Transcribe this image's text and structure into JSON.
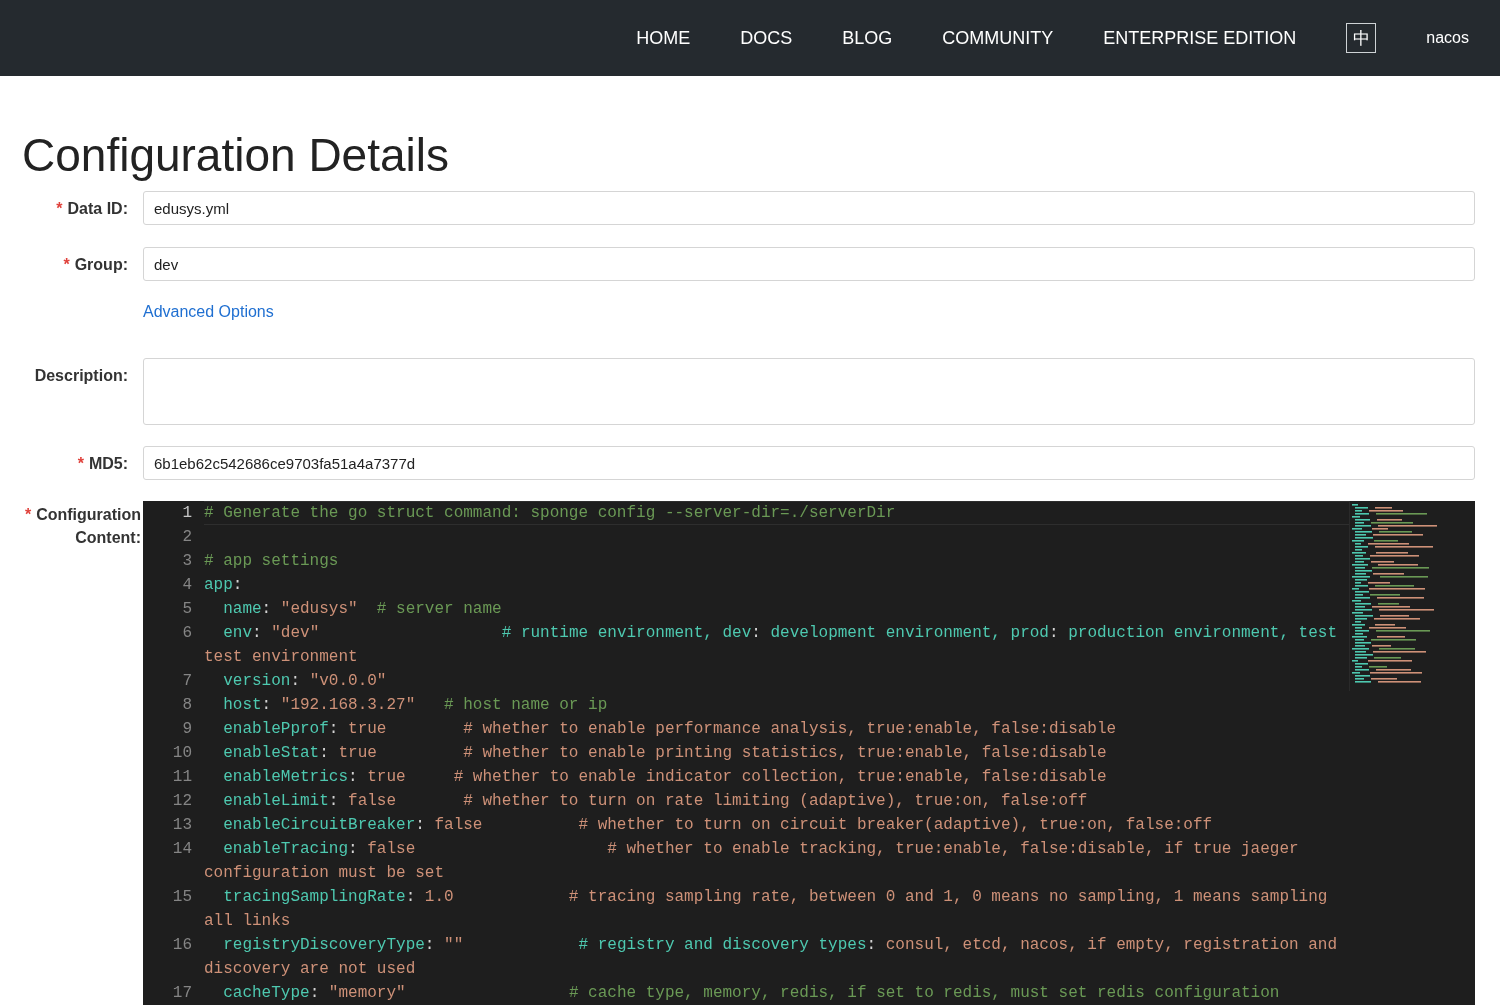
{
  "nav": {
    "items": [
      "HOME",
      "DOCS",
      "BLOG",
      "COMMUNITY",
      "ENTERPRISE EDITION"
    ],
    "language_toggle": "中",
    "user": "nacos"
  },
  "title": "Configuration Details",
  "required_mark": "*",
  "fields": [
    {
      "kind": "input",
      "label": "Data ID:",
      "required": true,
      "value": "edusys.yml"
    },
    {
      "kind": "input",
      "label": "Group:",
      "required": true,
      "value": "dev"
    },
    {
      "kind": "link",
      "text": "Advanced Options"
    },
    {
      "kind": "textarea",
      "label": "Description:",
      "required": false
    },
    {
      "kind": "input",
      "label": "MD5:",
      "required": true,
      "value": "6b1eb62c542686ce9703fa51a4a7377d"
    }
  ],
  "editor": {
    "label_lines": [
      "Configuration",
      "Content:"
    ],
    "required": true,
    "lines": [
      {
        "number": "1",
        "current": true,
        "rows": [
          [
            {
              "kind": "comment",
              "text": "# Generate the go struct command: sponge config --server-dir=./serverDir"
            }
          ]
        ]
      },
      {
        "number": "2",
        "current": false,
        "rows": [
          []
        ]
      },
      {
        "number": "3",
        "current": false,
        "rows": [
          [
            {
              "kind": "comment",
              "text": "# app settings"
            }
          ]
        ]
      },
      {
        "number": "4",
        "current": false,
        "rows": [
          [
            {
              "kind": "key",
              "text": "app"
            },
            {
              "kind": "punct",
              "text": ":"
            }
          ]
        ]
      },
      {
        "number": "5",
        "current": false,
        "rows": [
          [
            {
              "kind": "plain",
              "text": "  "
            },
            {
              "kind": "key",
              "text": "name"
            },
            {
              "kind": "punct",
              "text": ": "
            },
            {
              "kind": "value",
              "text": "\"edusys\""
            },
            {
              "kind": "plain",
              "text": "  "
            },
            {
              "kind": "comment",
              "text": "# server name"
            }
          ]
        ]
      },
      {
        "number": "6",
        "current": false,
        "rows": [
          [
            {
              "kind": "plain",
              "text": "  "
            },
            {
              "kind": "key",
              "text": "env"
            },
            {
              "kind": "punct",
              "text": ": "
            },
            {
              "kind": "value",
              "text": "\"dev\""
            },
            {
              "kind": "plain",
              "text": "                   "
            },
            {
              "kind": "key",
              "text": "# runtime environment, dev"
            },
            {
              "kind": "punct",
              "text": ": "
            },
            {
              "kind": "key",
              "text": "development environment, prod"
            },
            {
              "kind": "punct",
              "text": ": "
            },
            {
              "kind": "key",
              "text": "production environment, test"
            }
          ],
          [
            {
              "kind": "value",
              "text": "test environment"
            }
          ]
        ]
      },
      {
        "number": "7",
        "current": false,
        "rows": [
          [
            {
              "kind": "plain",
              "text": "  "
            },
            {
              "kind": "key",
              "text": "version"
            },
            {
              "kind": "punct",
              "text": ": "
            },
            {
              "kind": "value",
              "text": "\"v0.0.0\""
            }
          ]
        ]
      },
      {
        "number": "8",
        "current": false,
        "rows": [
          [
            {
              "kind": "plain",
              "text": "  "
            },
            {
              "kind": "key",
              "text": "host"
            },
            {
              "kind": "punct",
              "text": ": "
            },
            {
              "kind": "value",
              "text": "\"192.168.3.27\""
            },
            {
              "kind": "plain",
              "text": "   "
            },
            {
              "kind": "comment",
              "text": "# host name or ip"
            }
          ]
        ]
      },
      {
        "number": "9",
        "current": false,
        "rows": [
          [
            {
              "kind": "plain",
              "text": "  "
            },
            {
              "kind": "key",
              "text": "enablePprof"
            },
            {
              "kind": "punct",
              "text": ": "
            },
            {
              "kind": "value",
              "text": "true        # whether to enable performance analysis, true:enable, false:disable"
            }
          ]
        ]
      },
      {
        "number": "10",
        "current": false,
        "rows": [
          [
            {
              "kind": "plain",
              "text": "  "
            },
            {
              "kind": "key",
              "text": "enableStat"
            },
            {
              "kind": "punct",
              "text": ": "
            },
            {
              "kind": "value",
              "text": "true         # whether to enable printing statistics, true:enable, false:disable"
            }
          ]
        ]
      },
      {
        "number": "11",
        "current": false,
        "rows": [
          [
            {
              "kind": "plain",
              "text": "  "
            },
            {
              "kind": "key",
              "text": "enableMetrics"
            },
            {
              "kind": "punct",
              "text": ": "
            },
            {
              "kind": "value",
              "text": "true     # whether to enable indicator collection, true:enable, false:disable"
            }
          ]
        ]
      },
      {
        "number": "12",
        "current": false,
        "rows": [
          [
            {
              "kind": "plain",
              "text": "  "
            },
            {
              "kind": "key",
              "text": "enableLimit"
            },
            {
              "kind": "punct",
              "text": ": "
            },
            {
              "kind": "value",
              "text": "false       # whether to turn on rate limiting (adaptive), true:on, false:off"
            }
          ]
        ]
      },
      {
        "number": "13",
        "current": false,
        "rows": [
          [
            {
              "kind": "plain",
              "text": "  "
            },
            {
              "kind": "key",
              "text": "enableCircuitBreaker"
            },
            {
              "kind": "punct",
              "text": ": "
            },
            {
              "kind": "value",
              "text": "false          # whether to turn on circuit breaker(adaptive), true:on, false:off"
            }
          ]
        ]
      },
      {
        "number": "14",
        "current": false,
        "rows": [
          [
            {
              "kind": "plain",
              "text": "  "
            },
            {
              "kind": "key",
              "text": "enableTracing"
            },
            {
              "kind": "punct",
              "text": ": "
            },
            {
              "kind": "value",
              "text": "false                    # whether to enable tracking, true:enable, false:disable, if true jaeger"
            }
          ],
          [
            {
              "kind": "value",
              "text": "configuration must be set"
            }
          ]
        ]
      },
      {
        "number": "15",
        "current": false,
        "rows": [
          [
            {
              "kind": "plain",
              "text": "  "
            },
            {
              "kind": "key",
              "text": "tracingSamplingRate"
            },
            {
              "kind": "punct",
              "text": ": "
            },
            {
              "kind": "value",
              "text": "1.0            # tracing sampling rate, between 0 and 1, 0 means no sampling, 1 means sampling"
            }
          ],
          [
            {
              "kind": "value",
              "text": "all links"
            }
          ]
        ]
      },
      {
        "number": "16",
        "current": false,
        "rows": [
          [
            {
              "kind": "plain",
              "text": "  "
            },
            {
              "kind": "key",
              "text": "registryDiscoveryType"
            },
            {
              "kind": "punct",
              "text": ": "
            },
            {
              "kind": "value",
              "text": "\"\""
            },
            {
              "kind": "plain",
              "text": "            "
            },
            {
              "kind": "key",
              "text": "# registry and discovery types"
            },
            {
              "kind": "punct",
              "text": ": "
            },
            {
              "kind": "value",
              "text": "consul, etcd, nacos, if empty, registration and"
            }
          ],
          [
            {
              "kind": "value",
              "text": "discovery are not used"
            }
          ]
        ]
      },
      {
        "number": "17",
        "current": false,
        "rows": [
          [
            {
              "kind": "plain",
              "text": "  "
            },
            {
              "kind": "key",
              "text": "cacheType"
            },
            {
              "kind": "punct",
              "text": ": "
            },
            {
              "kind": "value",
              "text": "\"memory\""
            },
            {
              "kind": "plain",
              "text": "                 "
            },
            {
              "kind": "comment",
              "text": "# cache type, memory, redis, if set to redis, must set redis configuration"
            }
          ]
        ]
      }
    ]
  }
}
